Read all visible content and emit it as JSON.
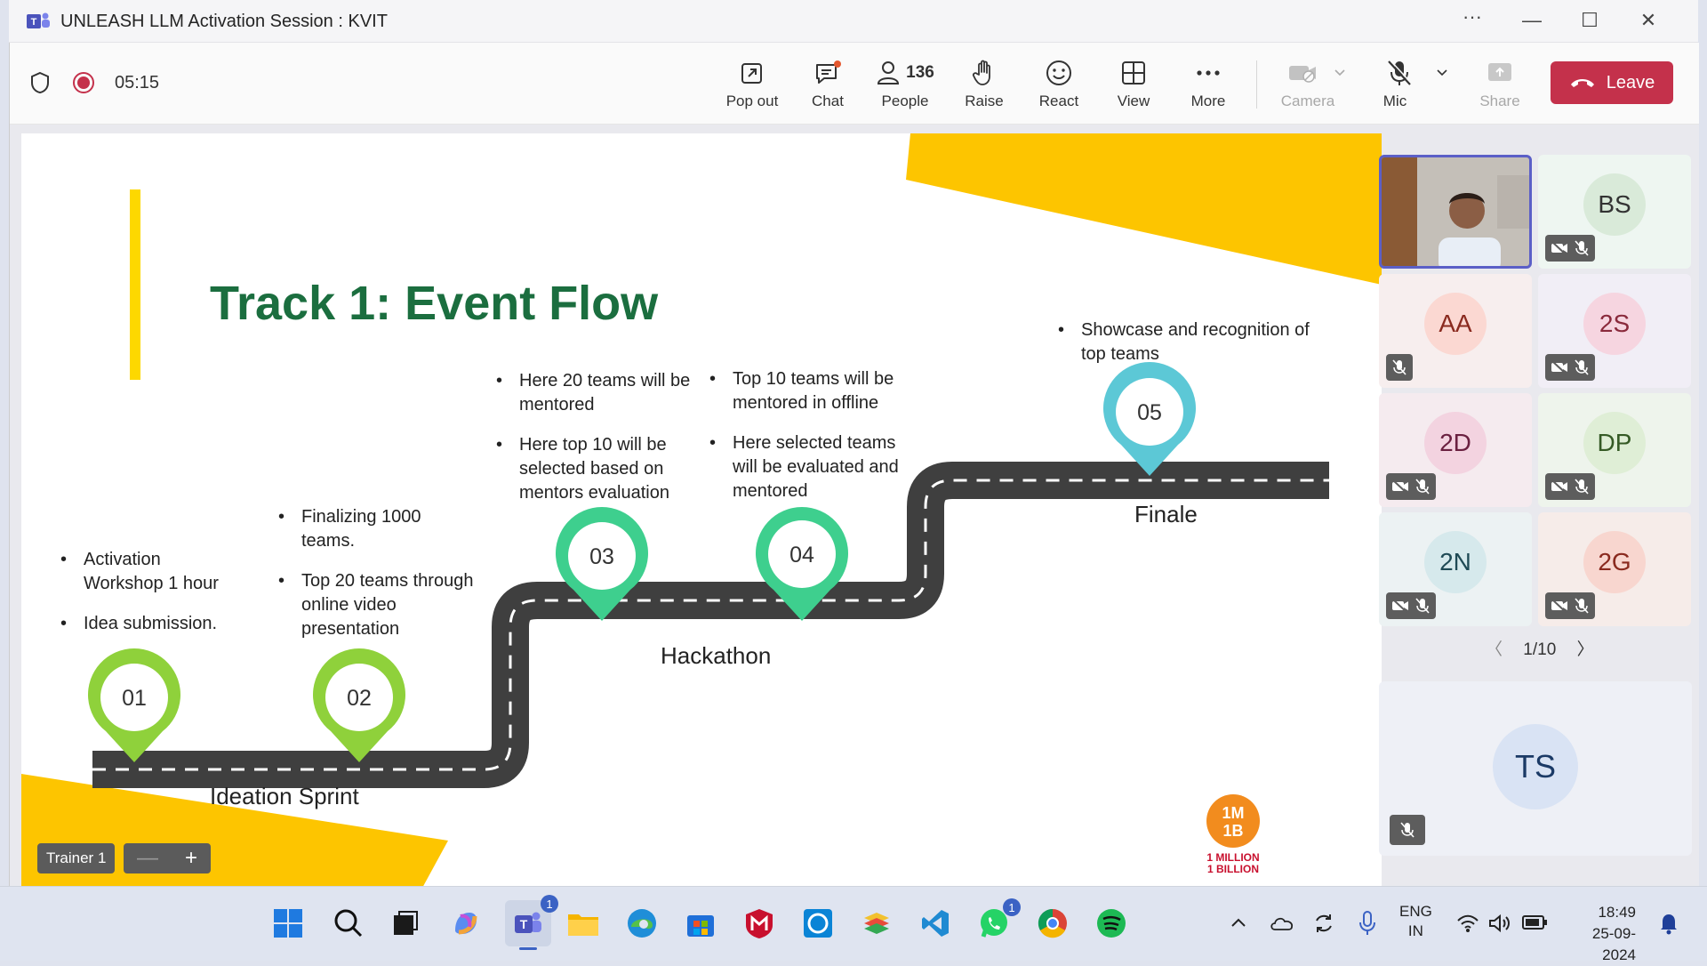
{
  "window": {
    "title": "UNLEASH LLM Activation Session : KVIT",
    "more_icon": "ellipsis-icon",
    "minimize": "—",
    "maximize": "☐",
    "close": "✕"
  },
  "meeting": {
    "timer": "05:15",
    "toolbar": [
      {
        "id": "popout",
        "label": "Pop out",
        "icon": "popout-icon"
      },
      {
        "id": "chat",
        "label": "Chat",
        "icon": "chat-icon"
      },
      {
        "id": "people",
        "label": "People",
        "icon": "people-icon",
        "count": "136"
      },
      {
        "id": "raise",
        "label": "Raise",
        "icon": "hand-icon"
      },
      {
        "id": "react",
        "label": "React",
        "icon": "smile-icon"
      },
      {
        "id": "view",
        "label": "View",
        "icon": "grid-icon"
      },
      {
        "id": "more",
        "label": "More",
        "icon": "ellipsis-icon"
      },
      {
        "id": "camera",
        "label": "Camera",
        "icon": "camera-off-icon"
      },
      {
        "id": "mic",
        "label": "Mic",
        "icon": "mic-off-icon"
      },
      {
        "id": "share",
        "label": "Share",
        "icon": "share-icon"
      }
    ],
    "leave_label": "Leave"
  },
  "slide": {
    "title": "Track 1: Event Flow",
    "stages": [
      {
        "num": "01",
        "bullets": [
          "Activation Workshop 1 hour",
          "Idea submission."
        ]
      },
      {
        "num": "02",
        "bullets": [
          "Finalizing 1000 teams.",
          "Top 20 teams through online video presentation"
        ]
      },
      {
        "num": "03",
        "bullets": [
          "Here 20 teams will be mentored",
          "Here top 10 will be selected based on mentors evaluation"
        ]
      },
      {
        "num": "04",
        "bullets": [
          "Top 10 teams will be mentored in offline",
          "Here selected teams will be evaluated and mentored"
        ]
      },
      {
        "num": "05",
        "bullets": [
          "Showcase and recognition of top  teams"
        ]
      }
    ],
    "phase_labels": [
      "Ideation Sprint",
      "Hackathon",
      "Finale"
    ],
    "logo_text": [
      "1M",
      "1B",
      "1 MILLION",
      "1 BILLION"
    ],
    "presenter_tag": "Trainer 1",
    "zoom_minus": "—",
    "zoom_plus": "+"
  },
  "participants": [
    {
      "initials": "",
      "video": true
    },
    {
      "initials": "BS",
      "bg": "#dff0e4"
    },
    {
      "initials": "AA",
      "bg": "#fde0dc"
    },
    {
      "initials": "2S",
      "bg": "#f6dde6"
    },
    {
      "initials": "2D",
      "bg": "#f5dde6"
    },
    {
      "initials": "DP",
      "bg": "#e3efdc"
    },
    {
      "initials": "2N",
      "bg": "#dcebee"
    },
    {
      "initials": "2G",
      "bg": "#fbe0dc"
    }
  ],
  "pager": "1/10",
  "spotlight": {
    "initials": "TS"
  },
  "taskbar": {
    "apps": [
      "start-icon",
      "search-icon",
      "task-view-icon",
      "copilot-icon",
      "teams-icon",
      "file-explorer-icon",
      "edge-icon",
      "store-icon",
      "mcafee-icon",
      "alexa-icon",
      "bluestacks-icon",
      "vscode-icon",
      "whatsapp-icon",
      "chrome-icon",
      "spotify-icon"
    ],
    "teams_badge": "1",
    "whatsapp_badge": "1",
    "lang": "ENG",
    "region": "IN",
    "time": "18:49",
    "date": "25-09-2024"
  }
}
